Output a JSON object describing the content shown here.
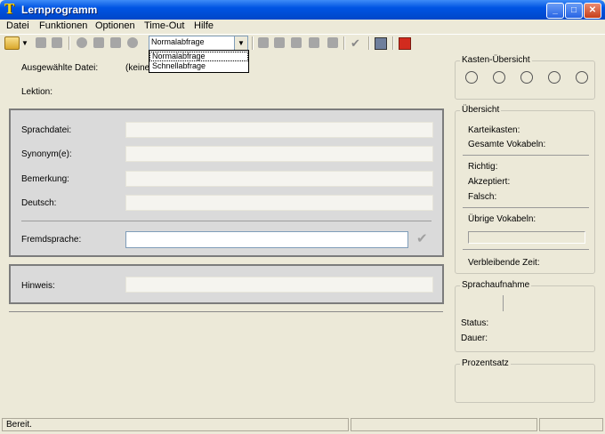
{
  "window": {
    "title": "Lernprogramm",
    "controls": [
      "minimize",
      "maximize",
      "close"
    ]
  },
  "menu": [
    "Datei",
    "Funktionen",
    "Optionen",
    "Time-Out",
    "Hilfe"
  ],
  "toolbar": {
    "mode_select": {
      "value": "Normalabfrage",
      "options": [
        "Normalabfrage",
        "Schnellabfrage"
      ],
      "open": true,
      "highlighted": "Normalabfrage"
    }
  },
  "main": {
    "selected_file_label": "Ausgewählte Datei:",
    "selected_file_value": "(keine",
    "lesson_label": "Lektion:",
    "fields": {
      "sprachdatei": "Sprachdatei:",
      "synonyme": "Synonym(e):",
      "bemerkung": "Bemerkung:",
      "deutsch": "Deutsch:",
      "fremdsprache": "Fremdsprache:",
      "hinweis": "Hinweis:"
    }
  },
  "right": {
    "kasten_title": "Kasten-Übersicht",
    "uebersicht_title": "Übersicht",
    "karteikasten": "Karteikasten:",
    "gesamte_vokabeln": "Gesamte Vokabeln:",
    "richtig": "Richtig:",
    "akzeptiert": "Akzeptiert:",
    "falsch": "Falsch:",
    "uebrige_vokabeln": "Übrige Vokabeln:",
    "verbleibende_zeit": "Verbleibende Zeit:",
    "sprachaufnahme_title": "Sprachaufnahme",
    "status": "Status:",
    "dauer": "Dauer:",
    "prozentsatz_title": "Prozentsatz"
  },
  "statusbar": {
    "text": "Bereit."
  }
}
